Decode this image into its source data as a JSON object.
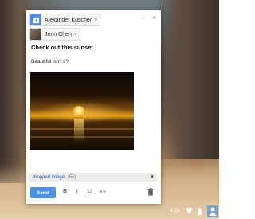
{
  "compose": {
    "recipients": [
      {
        "name": "Alexander Kuscher",
        "remove": "×"
      },
      {
        "name": "Jenn Chen",
        "remove": "×"
      }
    ],
    "subject": "Check out this sunset",
    "body": "Beautiful isn't it?",
    "window_controls": {
      "minimize": "–",
      "close": "×"
    },
    "attachment": {
      "name": "dropped image",
      "size": "(5k)",
      "remove": "×"
    },
    "toolbar": {
      "send_label": "Send",
      "bold": "B",
      "italic": "I",
      "underline": "U",
      "link": "⊖⊖"
    }
  },
  "shelf": {
    "time": "4:03",
    "icons": [
      "wifi-icon",
      "battery-icon",
      "user-icon"
    ]
  }
}
